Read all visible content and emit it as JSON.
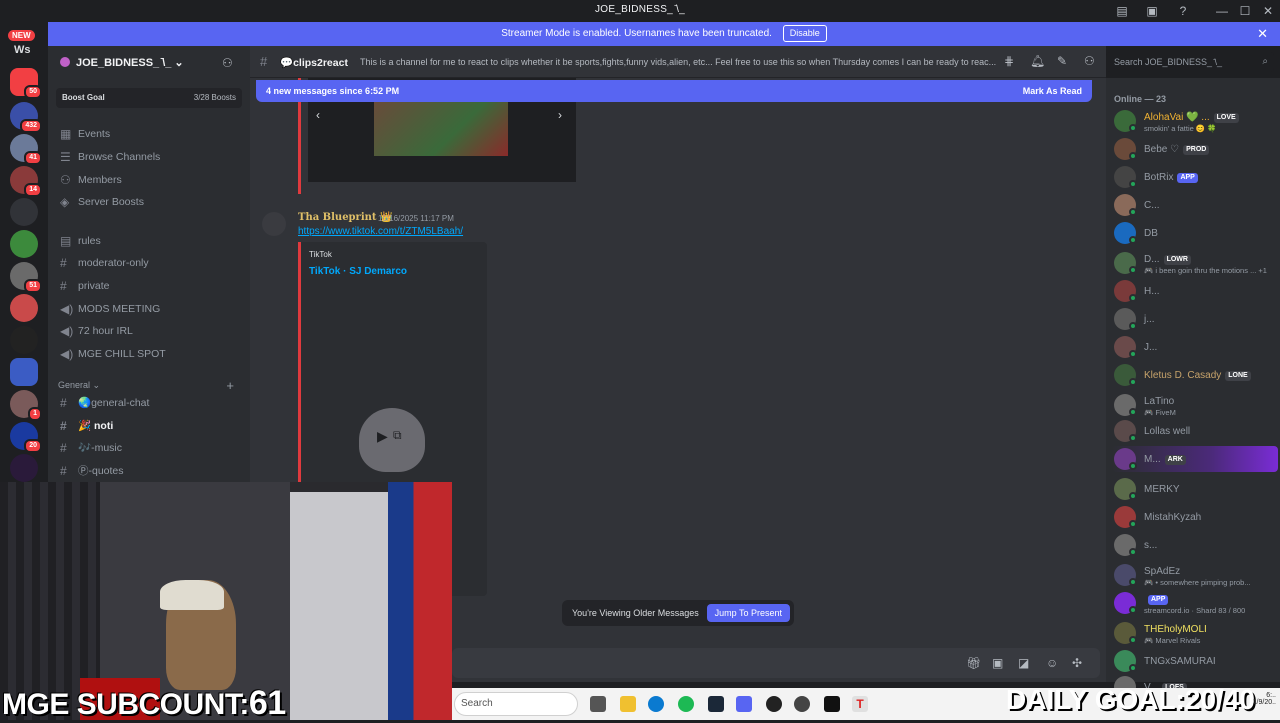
{
  "window": {
    "title": "JOE_BIDNESS_ ̄\\_",
    "controls": [
      "—",
      "☐",
      "✕"
    ]
  },
  "banner": {
    "text": "Streamer Mode is enabled. Usernames have been truncated.",
    "disable_label": "Disable",
    "close": "✕"
  },
  "rail": {
    "new_badge": "NEW",
    "ws_label": "Ws",
    "counts": [
      "50",
      "432",
      "41",
      "14",
      "51",
      "1",
      "20"
    ]
  },
  "sidebar": {
    "guild_name": "JOE_BIDNESS_ ̄\\_",
    "boost_goal": "Boost Goal",
    "boost_count": "3/28 Boosts",
    "nav": [
      "Events",
      "Browse Channels",
      "Members",
      "Server Boosts"
    ],
    "channels": [
      "rules",
      "moderator-only",
      "private",
      "MODS MEETING",
      "72 hour IRL",
      "MGE CHILL SPOT"
    ],
    "category": "General",
    "general_channels": [
      "🌏general-chat",
      "🎉 noti",
      "🎶-music",
      "Ⓟ-quotes"
    ]
  },
  "header": {
    "channel_name": "💬clips2react",
    "topic": "This is a channel for me to react to clips whether it be sports,fights,funny vids,alien, etc... Feel free to use this so when Thursday comes I can be ready to reac...",
    "search_placeholder": "Search JOE_BIDNESS_ ̄\\_"
  },
  "chat": {
    "new_messages": "4 new messages since 6:52 PM",
    "mark_read": "Mark As Read",
    "message": {
      "author": "Tha Blueprint 👑",
      "timestamp": "10/16/2025 11:17 PM",
      "link": "https://www.tiktok.com/t/ZTM5LBaah/",
      "embed_provider": "TikTok",
      "embed_title": "TikTok · SJ Demarco"
    },
    "older_notice": "You're Viewing Older Messages",
    "jump_label": "Jump To Present"
  },
  "members": {
    "header": "Online — 23",
    "list": [
      {
        "name": "AlohaVai 💚 ...",
        "status": "smokin' a fattie 😊 🍀",
        "tag": "LOVE",
        "color": "#f0b232"
      },
      {
        "name": "Bebe ♡",
        "status": "",
        "tag": "PROD",
        "color": "#949ba4"
      },
      {
        "name": "BotRix",
        "status": "",
        "tag": "APP",
        "color": "#949ba4"
      },
      {
        "name": "C...",
        "status": "",
        "tag": "",
        "color": "#949ba4"
      },
      {
        "name": "DB",
        "status": "",
        "tag": "",
        "color": "#949ba4"
      },
      {
        "name": "D...",
        "status": "🎮 i been goin thru the motions ... +1",
        "tag": "LOWR",
        "color": "#949ba4"
      },
      {
        "name": "H...",
        "status": "",
        "tag": "",
        "color": "#949ba4"
      },
      {
        "name": "j...",
        "status": "",
        "tag": "",
        "color": "#949ba4"
      },
      {
        "name": "J...",
        "status": "",
        "tag": "",
        "color": "#949ba4"
      },
      {
        "name": "Kletus D. Casady",
        "status": "",
        "tag": "LONE",
        "color": "#c7a36b"
      },
      {
        "name": "LaTino",
        "status": "🎮 FiveM",
        "tag": "",
        "color": "#949ba4"
      },
      {
        "name": "Lollas well",
        "status": "",
        "tag": "",
        "color": "#949ba4"
      },
      {
        "name": "M...",
        "status": "",
        "tag": "ARK",
        "color": "#949ba4"
      },
      {
        "name": "MERKY",
        "status": "",
        "tag": "",
        "color": "#949ba4"
      },
      {
        "name": "MistahKyzah",
        "status": "",
        "tag": "",
        "color": "#949ba4"
      },
      {
        "name": "s...",
        "status": "",
        "tag": "",
        "color": "#949ba4"
      },
      {
        "name": "SpAdEz",
        "status": "🎮 • somewhere pimping prob...",
        "tag": "",
        "color": "#949ba4"
      },
      {
        "name": "",
        "status": "streamcord.io · Shard 83 / 800",
        "tag": "APP",
        "color": "#949ba4"
      },
      {
        "name": "THEholyMOLI",
        "status": "🎮 Marvel Rivals",
        "tag": "",
        "color": "#f0e060"
      },
      {
        "name": "TNGxSAMURAI",
        "status": "",
        "tag": "",
        "color": "#949ba4"
      },
      {
        "name": "V...",
        "status": "",
        "tag": "LOFS",
        "color": "#949ba4"
      }
    ]
  },
  "overlay": {
    "subcount_label": "MGE SUBCOUNT:",
    "subcount_value": "61",
    "daily_goal": "DAILY GOAL:20/40"
  },
  "taskbar": {
    "search": "Search",
    "time": "6:..",
    "date": "1/9/20.."
  }
}
